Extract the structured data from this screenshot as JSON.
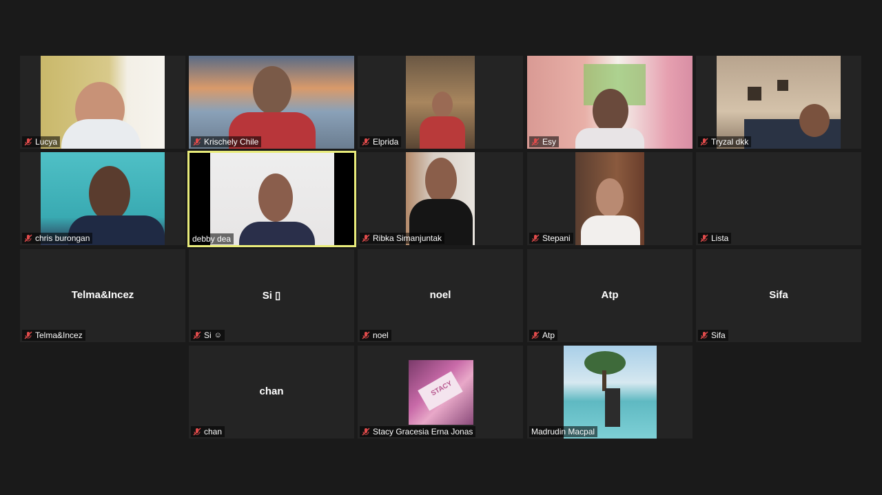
{
  "participants": [
    {
      "id": "lucya",
      "name": "Lucya",
      "muted": true
    },
    {
      "id": "krischely",
      "name": "Krischely Chile",
      "muted": true
    },
    {
      "id": "elprida",
      "name": "Elprida",
      "muted": true
    },
    {
      "id": "esy",
      "name": "Esy",
      "muted": true
    },
    {
      "id": "tryzal",
      "name": "Tryzal dkk",
      "muted": true
    },
    {
      "id": "chris",
      "name": "chris burongan",
      "muted": true
    },
    {
      "id": "debby",
      "name": "debby dea",
      "muted": false,
      "active_speaker": true
    },
    {
      "id": "ribka",
      "name": "Ribka Simanjuntak",
      "muted": true
    },
    {
      "id": "stepani",
      "name": "Stepani",
      "muted": true
    },
    {
      "id": "lista",
      "name": "Lista",
      "muted": true
    },
    {
      "id": "telma",
      "name": "Telma&Incez",
      "muted": true,
      "center": "Telma&Incez"
    },
    {
      "id": "si",
      "name": "Si",
      "muted": true,
      "center": "Si ▯",
      "emoji": "☺"
    },
    {
      "id": "noel",
      "name": "noel",
      "muted": true,
      "center": "noel"
    },
    {
      "id": "atp",
      "name": "Atp",
      "muted": true,
      "center": "Atp"
    },
    {
      "id": "sifa",
      "name": "Sifa",
      "muted": true,
      "center": "Sifa"
    },
    {
      "id": "chan",
      "name": "chan",
      "muted": true,
      "center": "chan"
    },
    {
      "id": "stacy",
      "name": "Stacy Gracesia Erna Jonas",
      "muted": true,
      "image_text": "STACY"
    },
    {
      "id": "madrudin",
      "name": "Madrudin Macpal",
      "muted": false
    }
  ],
  "colors": {
    "background": "#1a1a1a",
    "tile": "#242424",
    "active_border": "#e8eb7a",
    "mute_icon": "#e04b4b"
  }
}
